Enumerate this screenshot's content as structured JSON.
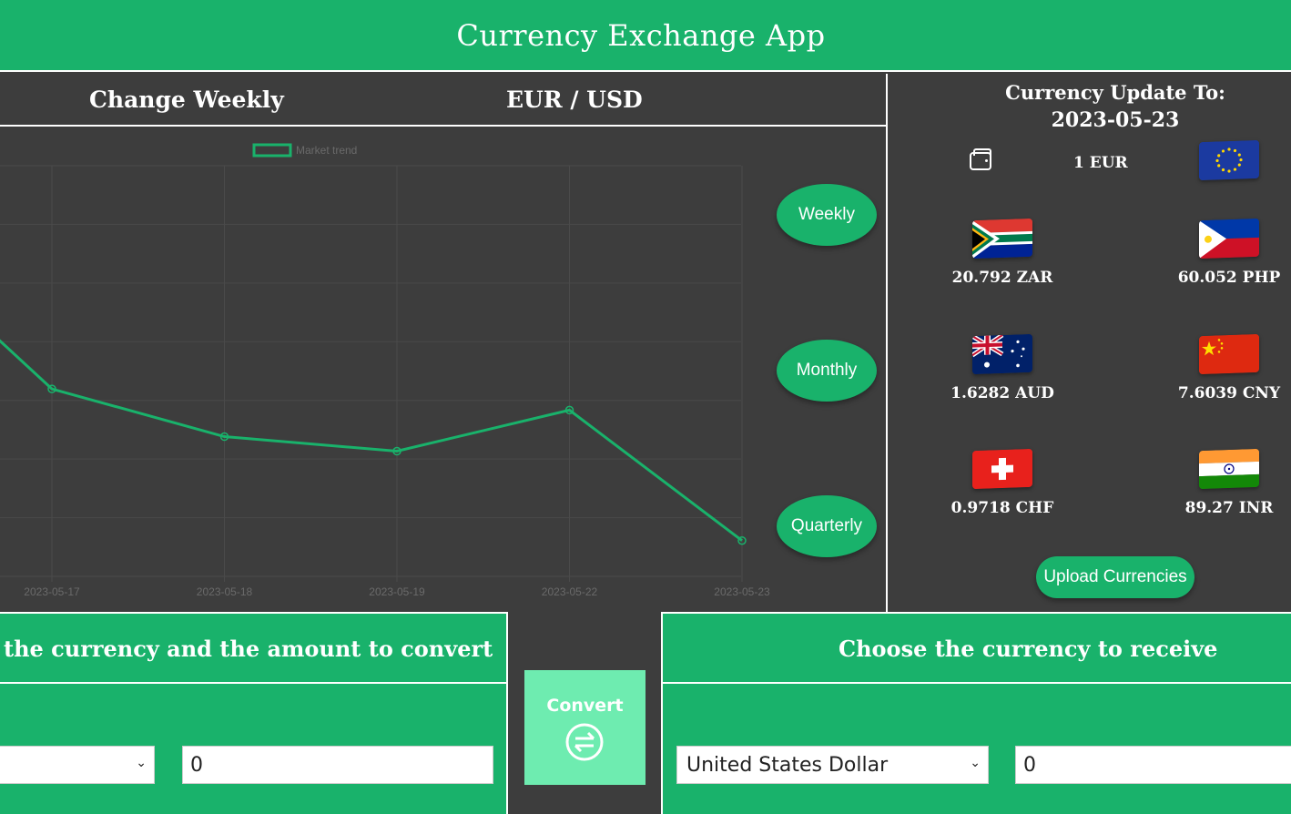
{
  "app": {
    "title": "Currency Exchange App"
  },
  "chart_panel": {
    "title_left": "Change Weekly",
    "title_right": "EUR / USD"
  },
  "chart_data": {
    "type": "line",
    "x": [
      "2023-05-17",
      "2023-05-18",
      "2023-05-19",
      "2023-05-22",
      "2023-05-23"
    ],
    "series": [
      {
        "name": "Market trend",
        "values": [
          1.0843,
          1.0771,
          1.0749,
          1.0811,
          1.0614
        ]
      }
    ],
    "y_range": [
      1.056,
      1.118
    ],
    "grid": true,
    "legend": "top-center",
    "color": "#19b26b"
  },
  "period_buttons": [
    "Weekly",
    "Monthly",
    "Quarterly"
  ],
  "rates_panel": {
    "title_line1": "Currency Update To:",
    "title_line2": "2023-05-23",
    "base_label": "1 EUR",
    "rates": [
      {
        "code": "ZAR",
        "label": "20.792 ZAR",
        "flag": "south-africa"
      },
      {
        "code": "PHP",
        "label": "60.052 PHP",
        "flag": "philippines"
      },
      {
        "code": "AUD",
        "label": "1.6282 AUD",
        "flag": "australia"
      },
      {
        "code": "CNY",
        "label": "7.6039 CNY",
        "flag": "china"
      },
      {
        "code": "CHF",
        "label": "0.9718 CHF",
        "flag": "switzerland"
      },
      {
        "code": "INR",
        "label": "89.27 INR",
        "flag": "india"
      }
    ],
    "upload_label": "Upload Currencies"
  },
  "convert_from": {
    "heading": "the currency and the amount to convert",
    "selected": "",
    "amount": "0"
  },
  "convert_button": {
    "label": "Convert"
  },
  "convert_to": {
    "heading": "Choose the currency to receive",
    "selected": "United States Dollar",
    "amount": "0"
  },
  "colors": {
    "brand": "#19b26b",
    "panel": "#3d3d3d",
    "convert_button": "#6eecb0"
  }
}
